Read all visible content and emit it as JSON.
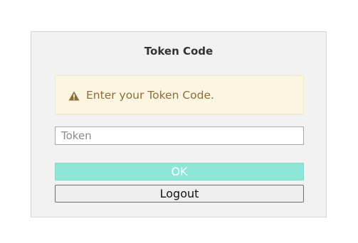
{
  "dialog": {
    "title": "Token Code"
  },
  "alert": {
    "icon": "warning-icon",
    "message": "Enter your Token Code.",
    "color": "#8a6d3b",
    "background": "#fcf5e1"
  },
  "token_field": {
    "value": "",
    "placeholder": "Token"
  },
  "buttons": {
    "ok_label": "OK",
    "logout_label": "Logout"
  },
  "colors": {
    "ok_button": "#8ee6d6",
    "logout_button": "#efefef"
  }
}
